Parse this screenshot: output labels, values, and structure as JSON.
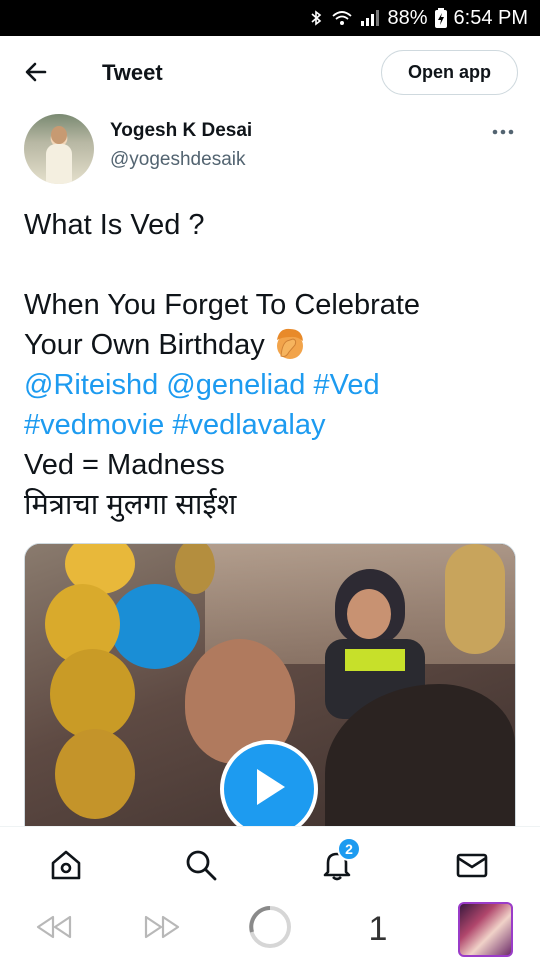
{
  "status_bar": {
    "icons": [
      "bluetooth-icon",
      "wifi-icon",
      "signal-icon",
      "battery-icon"
    ],
    "battery": "88%",
    "time": "6:54 PM"
  },
  "header": {
    "title": "Tweet",
    "open_app_label": "Open app",
    "back_icon": "arrow-left-icon"
  },
  "author": {
    "name": "Yogesh K Desai",
    "handle": "@yogeshdesaik",
    "more_icon": "more-horizontal-icon"
  },
  "tweet": {
    "line1": "What Is Ved ?",
    "line2": "When You Forget To Celebrate",
    "line3": "Your Own Birthday",
    "emoji": "face-palm-emoji",
    "mention1": "@Riteishd",
    "mention2": "@geneliad",
    "hashtag1": "#Ved",
    "hashtag2": "#vedmovie",
    "hashtag3": "#vedlavalay",
    "line6": "Ved = Madness",
    "line7": "मित्राचा मुलगा साईश"
  },
  "media": {
    "type": "video",
    "play_icon": "play-icon"
  },
  "bottom_nav": {
    "items": [
      "home-icon",
      "search-icon",
      "notifications-icon",
      "messages-icon"
    ],
    "notification_badge": "2"
  },
  "browser_bar": {
    "items": [
      "rewind-icon",
      "fast-forward-icon",
      "loading-icon"
    ],
    "tab_count": "1"
  },
  "colors": {
    "accent": "#1d9bf0",
    "text": "#0f1419",
    "muted": "#536471"
  }
}
